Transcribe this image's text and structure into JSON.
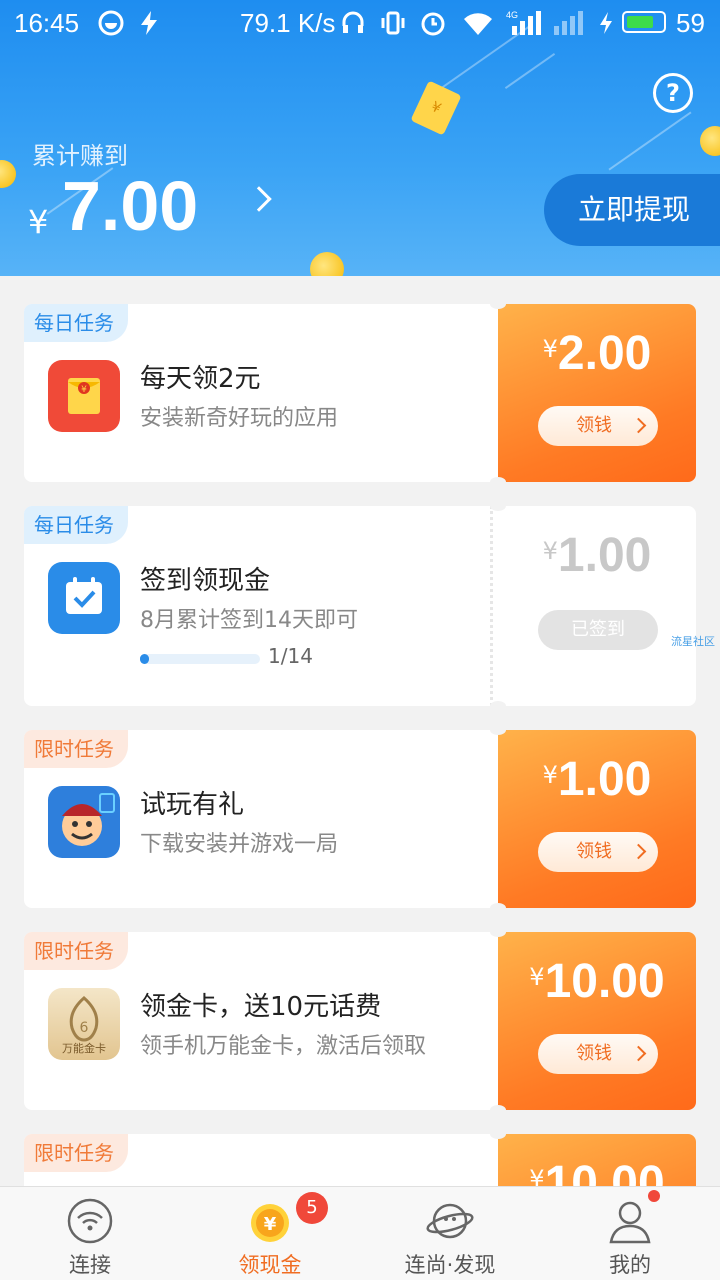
{
  "status_bar": {
    "time": "16:45",
    "speed": "79.1 K/s",
    "battery": "59",
    "network": "4G"
  },
  "header": {
    "earned_label": "累计赚到",
    "currency": "¥",
    "earned_amount": "7.00",
    "withdraw_label": "立即提现",
    "help_icon": "?"
  },
  "tasks": [
    {
      "tag": "每日任务",
      "tag_color": "#2a8ce8",
      "title": "每天领2元",
      "subtitle": "安装新奇好玩的应用",
      "currency": "¥",
      "amount": "2.00",
      "button": "领钱",
      "icon": "red-envelope-icon"
    },
    {
      "tag": "每日任务",
      "tag_color": "#2a8ce8",
      "title": "签到领现金",
      "subtitle": "8月累计签到14天即可",
      "currency": "¥",
      "amount": "1.00",
      "button": "已签到",
      "progress_text": "1/14",
      "progress": 0.0714,
      "icon": "calendar-check-icon"
    },
    {
      "tag": "限时任务",
      "tag_color": "#f07a38",
      "title": "试玩有礼",
      "subtitle": "下载安装并游戏一局",
      "currency": "¥",
      "amount": "1.00",
      "button": "领钱",
      "icon": "game-character-icon"
    },
    {
      "tag": "限时任务",
      "tag_color": "#f07a38",
      "title": "领金卡，送10元话费",
      "subtitle": "领手机万能金卡，激活后领取",
      "currency": "¥",
      "amount": "10.00",
      "button": "领钱",
      "icon": "gold-card-icon",
      "icon_text": "万能金卡"
    },
    {
      "tag": "限时任务",
      "tag_color": "#f07a38",
      "currency": "¥",
      "amount": "10.00"
    }
  ],
  "watermark": "流星社区",
  "tabbar": {
    "items": [
      {
        "label": "连接",
        "icon": "wifi-icon"
      },
      {
        "label": "领现金",
        "icon": "coin-icon",
        "badge": "5",
        "active": true
      },
      {
        "label": "连尚·发现",
        "icon": "planet-icon"
      },
      {
        "label": "我的",
        "icon": "user-icon"
      }
    ]
  }
}
